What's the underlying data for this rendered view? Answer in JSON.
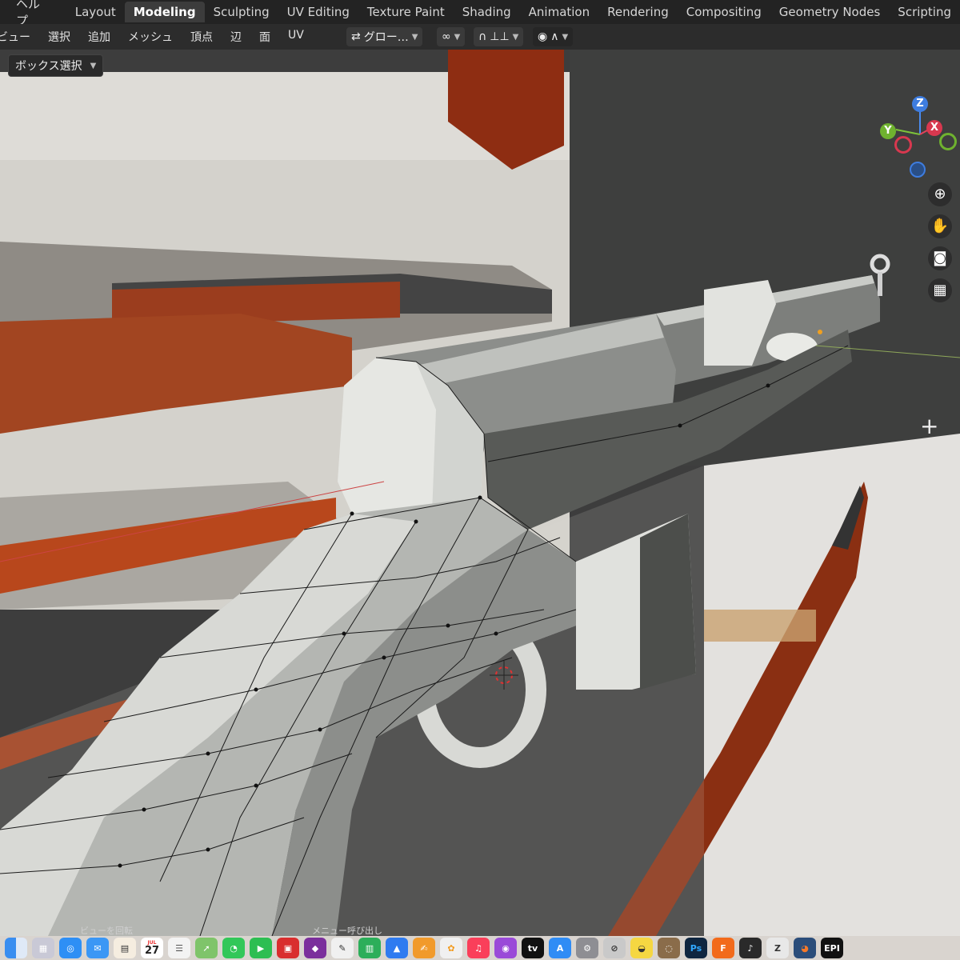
{
  "app": {
    "menu_left": [
      "ヘルプ"
    ],
    "workspace_tabs": [
      "Layout",
      "Modeling",
      "Sculpting",
      "UV Editing",
      "Texture Paint",
      "Shading",
      "Animation",
      "Rendering",
      "Compositing",
      "Geometry Nodes",
      "Scripting"
    ],
    "active_tab": "Modeling"
  },
  "header": {
    "menus": [
      "ビュー",
      "選択",
      "追加",
      "メッシュ",
      "頂点",
      "辺",
      "面",
      "UV"
    ],
    "transform_orientation": "グロー…",
    "select_mode": "ボックス選択"
  },
  "viewport": {
    "gizmo": {
      "z": "Z",
      "y": "Y",
      "x": "X"
    },
    "nav_buttons": [
      "zoom-icon",
      "hand-icon",
      "camera-icon",
      "grid-icon"
    ],
    "status_left": "ビューを回転",
    "status_right": "メニュー呼び出し",
    "colors": {
      "mesh_light": "#d9dbd7",
      "mesh_mid": "#a9aba8",
      "mesh_dark": "#5d5f5c",
      "background_dark": "#3d3d3d",
      "wood": "#9b3d1e"
    }
  },
  "dock": {
    "calendar_month": "JUL",
    "calendar_day": "27",
    "icons": [
      "finder",
      "launchpad",
      "safari",
      "mail",
      "calendar",
      "photos",
      "maps",
      "messages",
      "facetime",
      "pdf",
      "affinity",
      "numbers",
      "keynote",
      "pages",
      "books",
      "photos2",
      "music",
      "podcasts",
      "tv",
      "appstore",
      "settings",
      "system",
      "preview",
      "blender-misc",
      "photoshop",
      "fusion",
      "music2",
      "zbrush",
      "blender",
      "epic"
    ],
    "photoshop_label": "Ps",
    "epic_label": "EPI"
  }
}
